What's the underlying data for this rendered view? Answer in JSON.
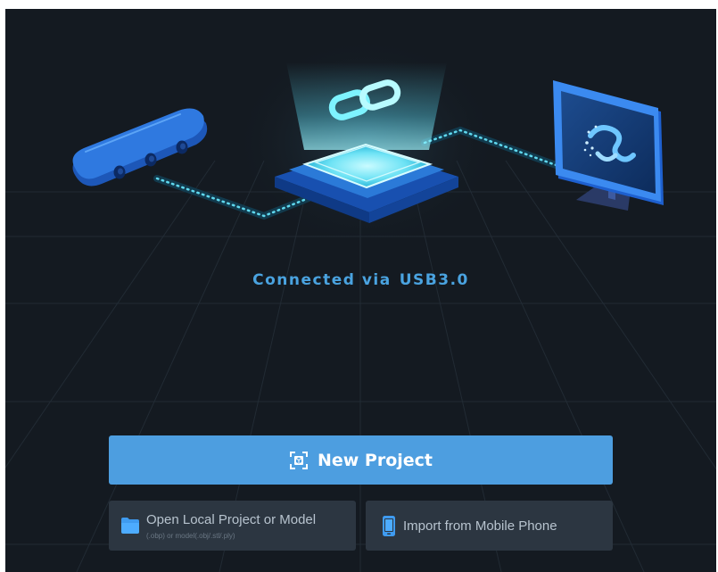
{
  "connection": {
    "prefix": "Connected via",
    "interface": "USB3.0"
  },
  "actions": {
    "new_project": {
      "label": "New Project",
      "icon": "scan-box-icon"
    },
    "open_local": {
      "title": "Open Local Project or Model",
      "subtitle": "(.obp) or model(.obj/.stl/.ply)",
      "icon": "folder-icon"
    },
    "import_mobile": {
      "title": "Import from Mobile Phone",
      "icon": "mobile-phone-icon"
    }
  },
  "illustration": {
    "devices": [
      "scanner-icon",
      "connection-hub-icon",
      "link-icon",
      "monitor-icon"
    ]
  },
  "colors": {
    "background": "#141a21",
    "accent": "#4d9ee0",
    "card": "#2c3641",
    "text_accent": "#4aa3e0",
    "glow": "#7ef3ff"
  }
}
